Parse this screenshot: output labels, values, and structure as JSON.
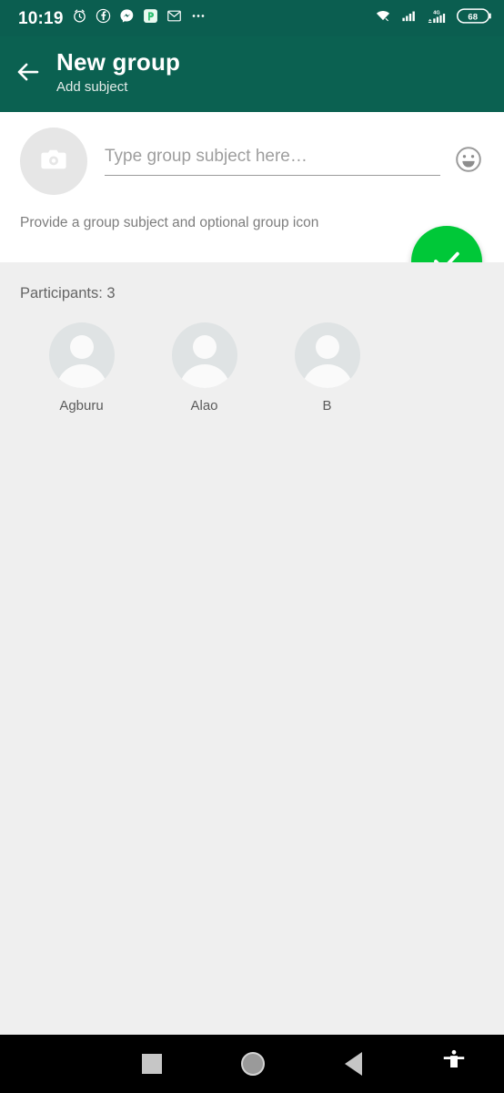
{
  "status_bar": {
    "time": "10:19",
    "battery_level": "68",
    "network_type": "4G",
    "icons": [
      "alarm-clock-icon",
      "facebook-icon",
      "messenger-icon",
      "palette-app-icon",
      "gmail-icon",
      "more-notifications-icon"
    ],
    "right_icons": [
      "wifi-icon",
      "signal-bars-icon",
      "signal-bars-4g-icon",
      "battery-icon"
    ],
    "background_color": "#0b5e50"
  },
  "app_bar": {
    "back_label": "back-arrow",
    "title": "New group",
    "subtitle": "Add subject",
    "background_color": "#0b6151"
  },
  "subject": {
    "placeholder": "Type group subject here…",
    "value": "",
    "camera_icon": "camera-icon",
    "emoji_icon": "emoji-smiley-icon",
    "hint": "Provide a group subject and optional group icon"
  },
  "fab": {
    "label": "create-group",
    "icon": "check-icon",
    "color": "#00c838"
  },
  "participants": {
    "count_label": "Participants: 3",
    "count": 3,
    "items": [
      {
        "name": "Agburu"
      },
      {
        "name": "Alao"
      },
      {
        "name": "B"
      }
    ]
  },
  "nav_bar": {
    "buttons": [
      "recents-square-icon",
      "home-circle-icon",
      "back-triangle-icon",
      "accessibility-icon"
    ],
    "background_color": "#000000"
  }
}
